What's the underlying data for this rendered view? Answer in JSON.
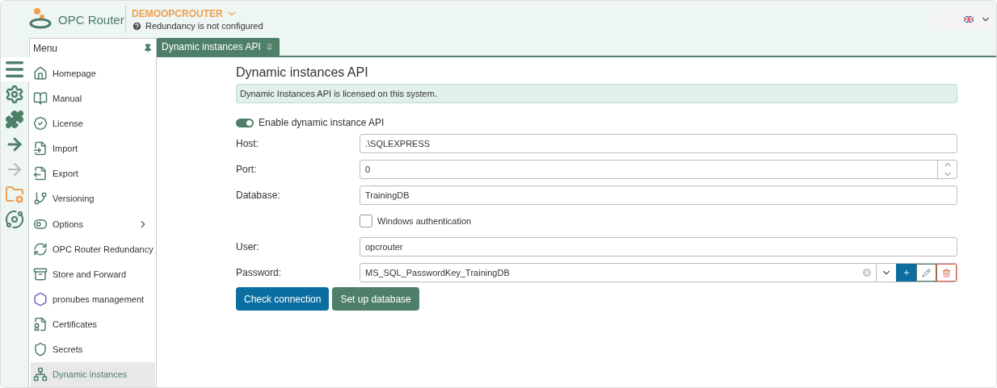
{
  "header": {
    "logo_text": "OPC Router",
    "server": "DEMOOPCROUTER",
    "status": "Redundancy is not configured"
  },
  "menu": {
    "title": "Menu",
    "items": [
      {
        "label": "Homepage",
        "selected": false,
        "has_submenu": false
      },
      {
        "label": "Manual",
        "selected": false,
        "has_submenu": false
      },
      {
        "label": "License",
        "selected": false,
        "has_submenu": false
      },
      {
        "label": "Import",
        "selected": false,
        "has_submenu": false
      },
      {
        "label": "Export",
        "selected": false,
        "has_submenu": false
      },
      {
        "label": "Versioning",
        "selected": false,
        "has_submenu": false
      },
      {
        "label": "Options",
        "selected": false,
        "has_submenu": true
      },
      {
        "label": "OPC Router Redundancy",
        "selected": false,
        "has_submenu": false
      },
      {
        "label": "Store and Forward",
        "selected": false,
        "has_submenu": false
      },
      {
        "label": "pronubes management",
        "selected": false,
        "has_submenu": false
      },
      {
        "label": "Certificates",
        "selected": false,
        "has_submenu": false
      },
      {
        "label": "Secrets",
        "selected": false,
        "has_submenu": false
      },
      {
        "label": "Dynamic instances",
        "selected": true,
        "has_submenu": false
      }
    ]
  },
  "tabs": [
    {
      "label": "Dynamic instances API",
      "selected": true
    }
  ],
  "form": {
    "title": "Dynamic instances API",
    "notice": "Dynamic Instances API is licensed on this system.",
    "toggle": {
      "label": "Enable dynamic instance API",
      "on": true
    },
    "fields": [
      {
        "kind": "text",
        "label": "Host:",
        "value": ".\\SQLEXPRESS"
      },
      {
        "kind": "number",
        "label": "Port:",
        "value": "0"
      },
      {
        "kind": "text",
        "label": "Database:",
        "value": "TrainingDB"
      },
      {
        "kind": "checkbox",
        "label": "Windows authentication",
        "checked": false
      },
      {
        "kind": "text",
        "label": "User:",
        "value": "opcrouter"
      },
      {
        "kind": "secret",
        "label": "Password:",
        "value": "MS_SQL_PasswordKey_TrainingDB"
      }
    ],
    "buttons": [
      {
        "label": "Check connection",
        "kind": "primary"
      },
      {
        "label": "Set up database",
        "kind": "secondary"
      }
    ]
  }
}
